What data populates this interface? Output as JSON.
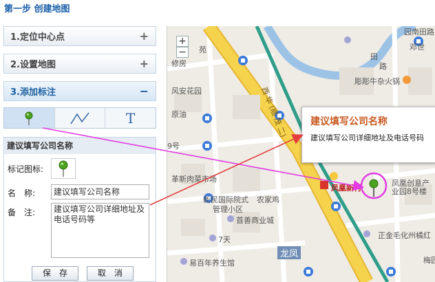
{
  "step_title": "第一步 创建地图",
  "accordion": [
    {
      "label": "1.定位中心点",
      "sign": "+"
    },
    {
      "label": "2.设置地图",
      "sign": "+"
    },
    {
      "label": "3.添加标注",
      "sign": "−"
    }
  ],
  "toolbar": {
    "tools": [
      "marker-tool-icon",
      "polyline-tool-icon",
      "text-tool-icon"
    ],
    "text_tool_letter": "T"
  },
  "form": {
    "header": "建议填写公司名称",
    "icon_label": "标记图标:",
    "name_label": "名　称:",
    "name_value": "建议填写公司名称",
    "note_label": "备　注:",
    "note_value": "建议填写公司详细地址及电话号码等",
    "save_label": "保　存",
    "cancel_label": "取　消"
  },
  "map": {
    "zoom_in": "+",
    "zoom_out": "−",
    "labels": {
      "l_fang": "苑",
      "l_xiufang": "修房",
      "l_fengan": "风安花园",
      "l_yuanyou": "原油",
      "l_hao9": "9号",
      "l_caishichang": "革新肉菜市场",
      "l_xinmin": "新民国际院式",
      "l_guanli": "管理小区",
      "l_nongjia": "农家鸡",
      "l_shouhui": "首善商业城",
      "l_qitian": "7天",
      "l_yibainian": "易百年养生馆",
      "l_longfeng": "龙凤",
      "l_fenghuangxincun": "凤凰新村",
      "l_fenghuangchuangyi": "凤凰创意产",
      "l_yeyuan": "业园8号楼",
      "l_maohua": "正金毛化州橘红",
      "l_meiyuan": "梅园",
      "l_yuantianlu": "园南田路",
      "l_dengshi": "邓世",
      "l_huoguo": "彫彫牛杂火锅",
      "l_road": "西 华 (顺 茂 二)",
      "l_tian": "田",
      "l_shi": "路"
    },
    "popup_title": "建议填写公司名称",
    "popup_text": "建议填写公司详细地址及电话号码",
    "colors": {
      "map_bg": "#efece6",
      "road_yellow": "#f5c93a",
      "river": "#9cc3e6",
      "metro": "#2e9d8a",
      "arrow_magenta": "#e23be3",
      "arrow_red": "#e43e3e",
      "popup_title": "#c85a22"
    }
  }
}
